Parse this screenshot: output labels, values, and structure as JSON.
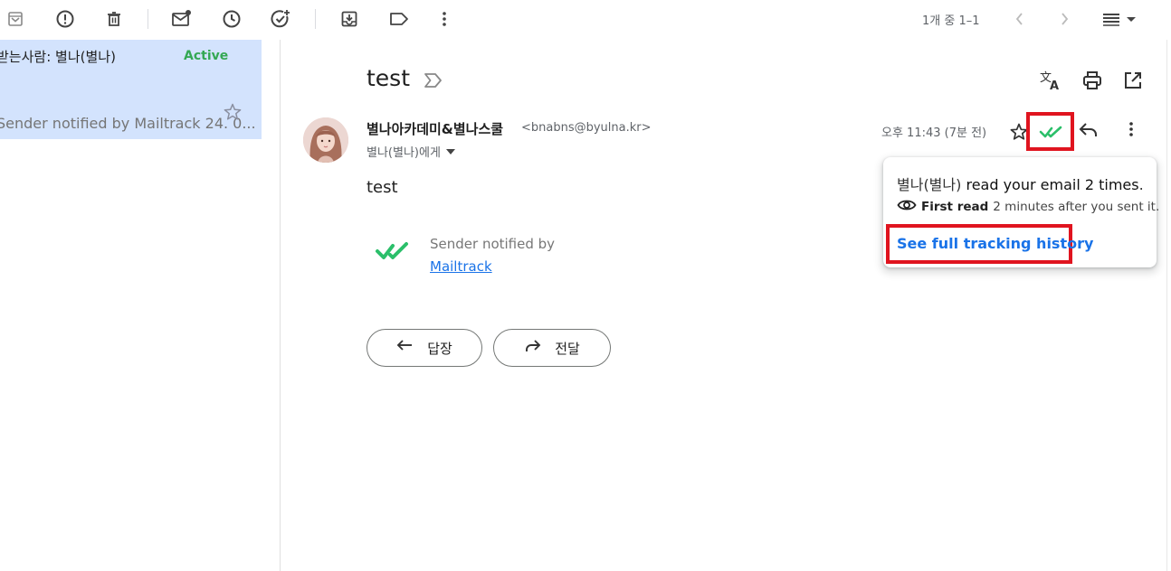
{
  "toolbar": {
    "page_count": "1개 중 1–1",
    "icons": [
      "archive-icon",
      "report-spam-icon",
      "delete-icon",
      "mark-unread-icon",
      "snooze-icon",
      "add-task-icon",
      "move-to-icon",
      "label-icon",
      "more-icon",
      "prev-icon",
      "next-icon",
      "density-icon"
    ]
  },
  "list_row": {
    "title": "받는사람: 별나(별나)",
    "status": "Active",
    "snippet": "Sender notified by Mailtrack 24. 0..."
  },
  "message": {
    "subject": "test",
    "sender_name": "별나아카데미&별나스쿨",
    "sender_email": "<bnabns@byulna.kr>",
    "recipient": "별나(별나)에게",
    "time": "오후 11:43 (7분 전)",
    "body": "test",
    "mailtrack_text": "Sender notified by",
    "mailtrack_link": "Mailtrack",
    "reply_label": "답장",
    "forward_label": "전달"
  },
  "popup": {
    "reader": "별나(별나)",
    "read_text": "read your email 2 times",
    "period": ".",
    "first_read_label": "First read",
    "first_read_detail": "2 minutes after you sent it.",
    "history_link": "See full tracking history"
  },
  "colors": {
    "accent": "#1a73e8",
    "selected_row": "#d3e3fd",
    "active_green": "#34a853",
    "highlight_red": "#e0141f",
    "check_green": "#2bbf6a"
  }
}
